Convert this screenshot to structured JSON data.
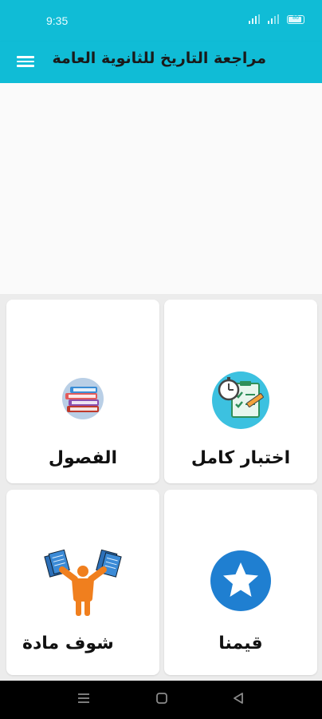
{
  "status_bar": {
    "time": "9:35",
    "battery_level": "86"
  },
  "app_bar": {
    "title": "مراجعة التاريخ للثانوية العامة",
    "menu_icon": "hamburger-menu-icon"
  },
  "cards": [
    {
      "label": "اختبار كامل",
      "icon": "stopwatch-quiz-icon"
    },
    {
      "label": "الفصول",
      "icon": "books-stack-icon"
    },
    {
      "label": "قيمنا",
      "icon": "star-rating-icon"
    },
    {
      "label": "شوف مادة",
      "icon": "person-holding-cards-icon"
    }
  ],
  "nav_bar": {
    "icons": [
      "recent-apps-icon",
      "home-icon",
      "back-icon"
    ]
  },
  "colors": {
    "app_bar": "#10bcd6",
    "grid_background": "#ececec",
    "star_circle": "#1f7fd1"
  }
}
